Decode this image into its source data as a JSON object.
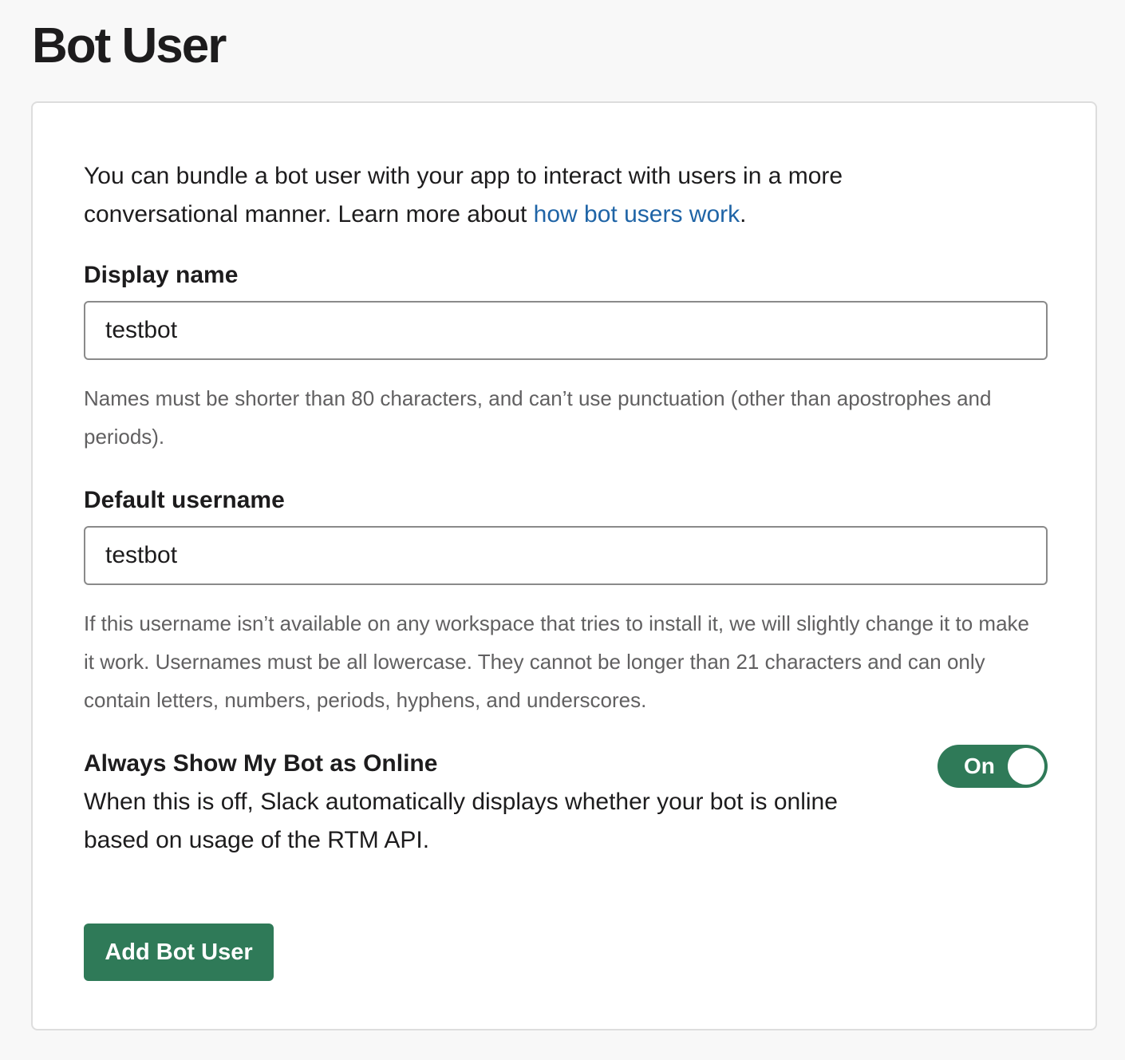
{
  "page": {
    "title": "Bot User"
  },
  "intro": {
    "text": "You can bundle a bot user with your app to interact with users in a more conversational manner. Learn more about ",
    "link_text": "how bot users work",
    "suffix": "."
  },
  "display_name": {
    "label": "Display name",
    "value": "testbot",
    "hint": "Names must be shorter than 80 characters, and can’t use punctuation (other than apostrophes and periods)."
  },
  "default_username": {
    "label": "Default username",
    "value": "testbot",
    "hint": "If this username isn’t available on any workspace that tries to install it, we will slightly change it to make it work. Usernames must be all lowercase. They cannot be longer than 21 characters and can only contain letters, numbers, periods, hyphens, and underscores."
  },
  "always_online": {
    "title": "Always Show My Bot as Online",
    "description": "When this is off, Slack automatically displays whether your bot is online based on usage of the RTM API.",
    "toggle_label": "On",
    "state": "on"
  },
  "actions": {
    "add_button": "Add Bot User"
  },
  "colors": {
    "accent": "#2f7a58",
    "link": "#1f64a6",
    "background": "#f8f8f8"
  }
}
